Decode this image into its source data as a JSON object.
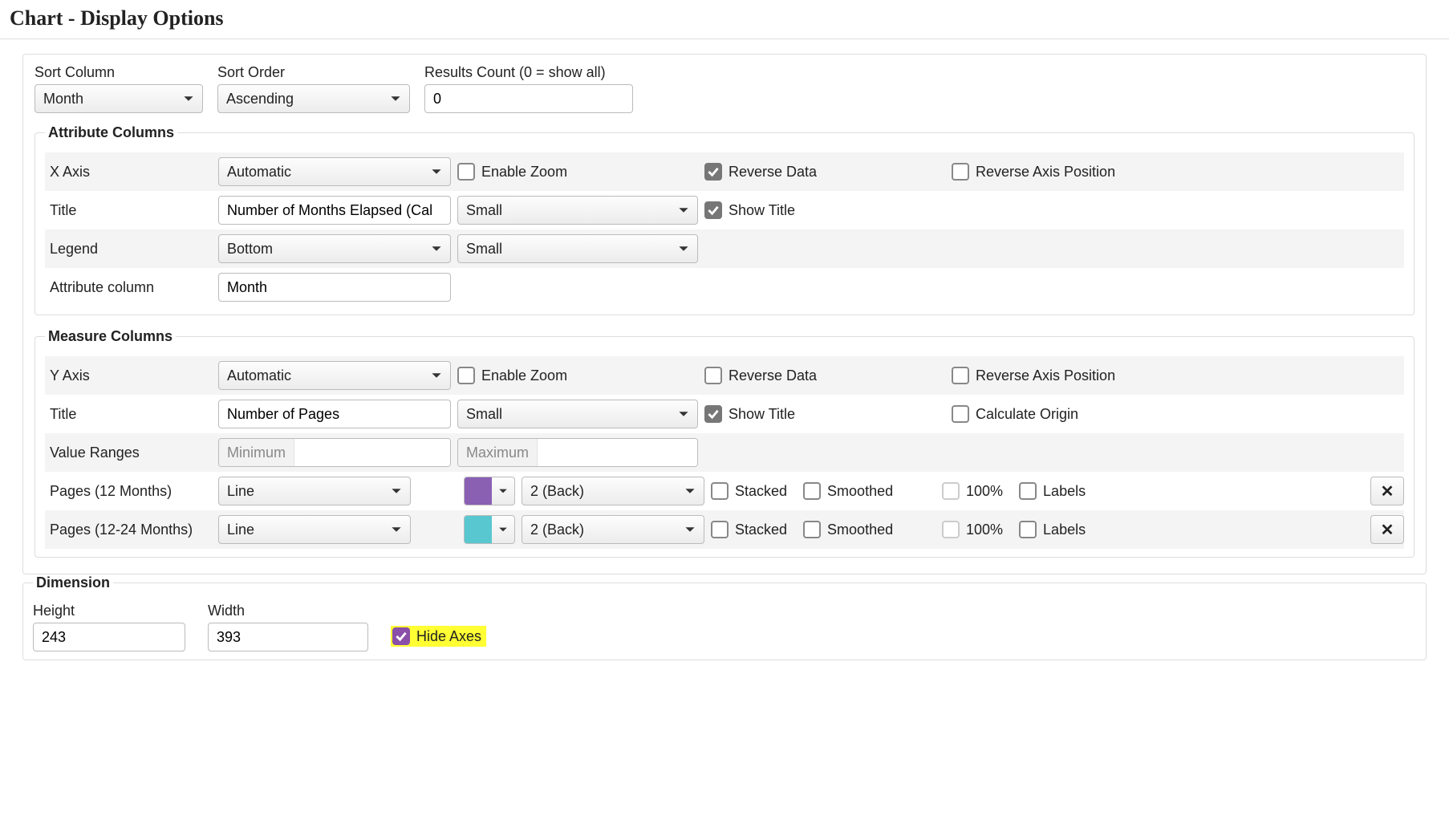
{
  "title": "Chart - Display Options",
  "topRow": {
    "sortColumn": {
      "label": "Sort Column",
      "value": "Month"
    },
    "sortOrder": {
      "label": "Sort Order",
      "value": "Ascending"
    },
    "resultsCount": {
      "label": "Results Count (0 = show all)",
      "value": "0"
    }
  },
  "attr": {
    "legend": "Attribute Columns",
    "xaxis": {
      "label": "X Axis",
      "value": "Automatic",
      "enableZoom": "Enable Zoom",
      "reverseData": "Reverse Data",
      "reverseAxisPos": "Reverse Axis Position"
    },
    "title": {
      "label": "Title",
      "value": "Number of Months Elapsed (Cal",
      "size": "Small",
      "showTitle": "Show Title"
    },
    "legendRow": {
      "label": "Legend",
      "value": "Bottom",
      "size": "Small"
    },
    "attrCol": {
      "label": "Attribute column",
      "value": "Month"
    }
  },
  "meas": {
    "legend": "Measure Columns",
    "yaxis": {
      "label": "Y Axis",
      "value": "Automatic",
      "enableZoom": "Enable Zoom",
      "reverseData": "Reverse Data",
      "reverseAxisPos": "Reverse Axis Position"
    },
    "title": {
      "label": "Title",
      "value": "Number of Pages",
      "size": "Small",
      "showTitle": "Show Title",
      "calcOrigin": "Calculate Origin"
    },
    "ranges": {
      "label": "Value Ranges",
      "minPH": "Minimum",
      "maxPH": "Maximum"
    },
    "series": [
      {
        "name": "Pages (12 Months)",
        "type": "Line",
        "color": "#8a60b3",
        "layer": "2 (Back)",
        "stacked": "Stacked",
        "smoothed": "Smoothed",
        "pct100": "100%",
        "labels": "Labels"
      },
      {
        "name": "Pages (12-24 Months)",
        "type": "Line",
        "color": "#58c7cf",
        "layer": "2 (Back)",
        "stacked": "Stacked",
        "smoothed": "Smoothed",
        "pct100": "100%",
        "labels": "Labels"
      }
    ]
  },
  "dim": {
    "legend": "Dimension",
    "height": {
      "label": "Height",
      "value": "243"
    },
    "width": {
      "label": "Width",
      "value": "393"
    },
    "hideAxes": "Hide Axes"
  }
}
